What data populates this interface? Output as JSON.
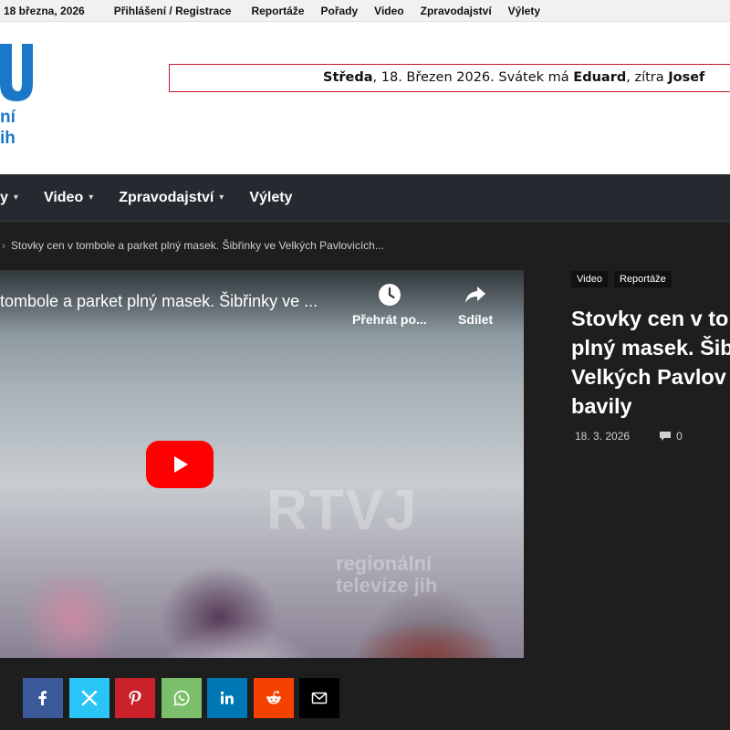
{
  "topbar": {
    "date": "18 března, 2026",
    "links": [
      "Přihlášení / Registrace",
      "Reportáže",
      "Pořady",
      "Video",
      "Zpravodajství",
      "Výlety"
    ]
  },
  "logo": {
    "line1": "ní",
    "line2": "ih"
  },
  "datebox": {
    "day": "Středa",
    "date_text": ", 18. Březen 2026. Svátek má ",
    "name_today": "Eduard",
    "tomorrow_text": ", zítra ",
    "name_tomorrow": "Josef"
  },
  "nav": {
    "items": [
      "y",
      "Video",
      "Zpravodajství",
      "Výlety"
    ]
  },
  "breadcrumb": {
    "current": "Stovky cen v tombole a parket plný masek. Šibřinky ve Velkých Pavlovicích..."
  },
  "video": {
    "title": "tombole a parket plný masek. Šibřinky ve ...",
    "watch_later_label": "Přehrát po...",
    "share_label": "Sdílet",
    "watermark_main": "RTVJ",
    "watermark_line1": "regionální",
    "watermark_line2": "televize jih"
  },
  "article": {
    "tags": [
      "Video",
      "Reportáže"
    ],
    "headline_lines": [
      "Stovky cen v to",
      "plný masek. Šib",
      "Velkých Pavlov",
      "bavily"
    ],
    "date": "18. 3. 2026",
    "comments": "0"
  },
  "colors": {
    "accent_blue": "#1b78c8",
    "nav_bg": "#242a30",
    "youtube_red": "#ff0000",
    "facebook": "#3b5998",
    "twitter": "#29c5f6",
    "pinterest": "#ca212a",
    "whatsapp": "#7bbf6a",
    "linkedin": "#0077b5",
    "reddit": "#f54200",
    "email": "#000000"
  },
  "share_icons": [
    "facebook-icon",
    "x-icon",
    "pinterest-icon",
    "whatsapp-icon",
    "linkedin-icon",
    "reddit-icon",
    "email-icon"
  ]
}
